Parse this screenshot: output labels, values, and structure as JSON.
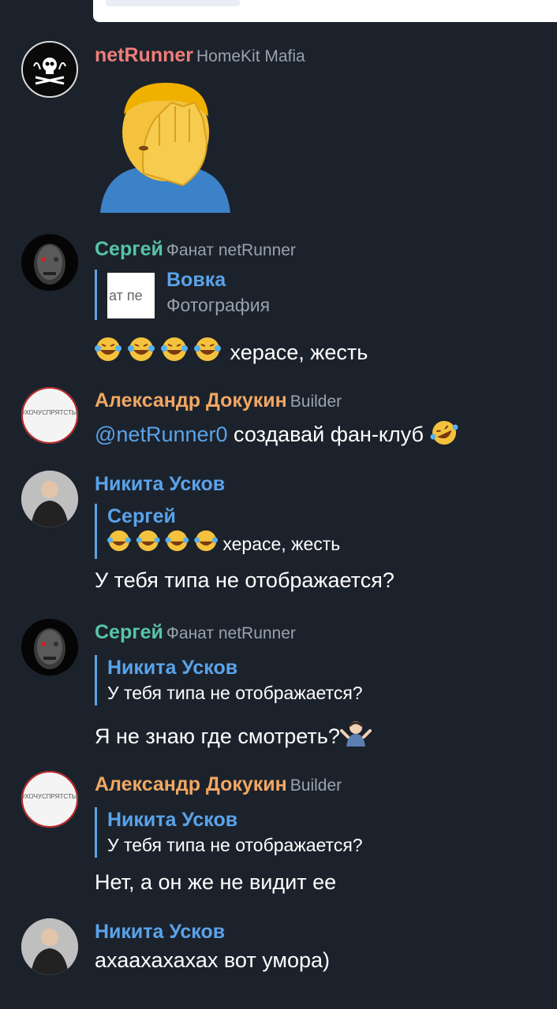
{
  "messages": [
    {
      "sender": "netRunner",
      "role": "HomeKit Mafia",
      "sticker": "facepalm-emoji"
    },
    {
      "sender": "Сергей",
      "role": "Фанат netRunner",
      "reply": {
        "name": "Вовка",
        "text": "Фотография",
        "thumb_text": "ат пе"
      },
      "text": "херасе, жесть",
      "emoji": "laugh-tears-emoji"
    },
    {
      "sender": "Александр Докукин",
      "role": "Builder",
      "mention": "@netRunner0",
      "text": "создавай фан-клуб",
      "emoji": "rofl-emoji",
      "avatar_text": "#ХОЧУСПРЯТСТЬК"
    },
    {
      "sender": "Никита Усков",
      "reply": {
        "name": "Сергей",
        "text": "херасе, жесть"
      },
      "text": "У тебя типа не отображается?"
    },
    {
      "sender": "Сергей",
      "role": "Фанат netRunner",
      "reply": {
        "name": "Никита Усков",
        "text": "У тебя типа не отображается?"
      },
      "text": "Я не знаю где смотреть?",
      "emoji": "shrug-emoji"
    },
    {
      "sender": "Александр Докукин",
      "role": "Builder",
      "reply": {
        "name": "Никита Усков",
        "text": "У тебя типа не отображается?"
      },
      "text": "Нет, а он же не видит ее",
      "avatar_text": "#ХОЧУСПРЯТСТЬК"
    },
    {
      "sender": "Никита Усков",
      "text": "ахаахахахах вот умора)"
    }
  ],
  "colors": {
    "background": "#1c222b",
    "link": "#5aa3ea",
    "name_teal": "#56c5a6",
    "name_orange": "#f0a763",
    "name_red": "#ee7d79",
    "muted": "#98a2ad"
  }
}
